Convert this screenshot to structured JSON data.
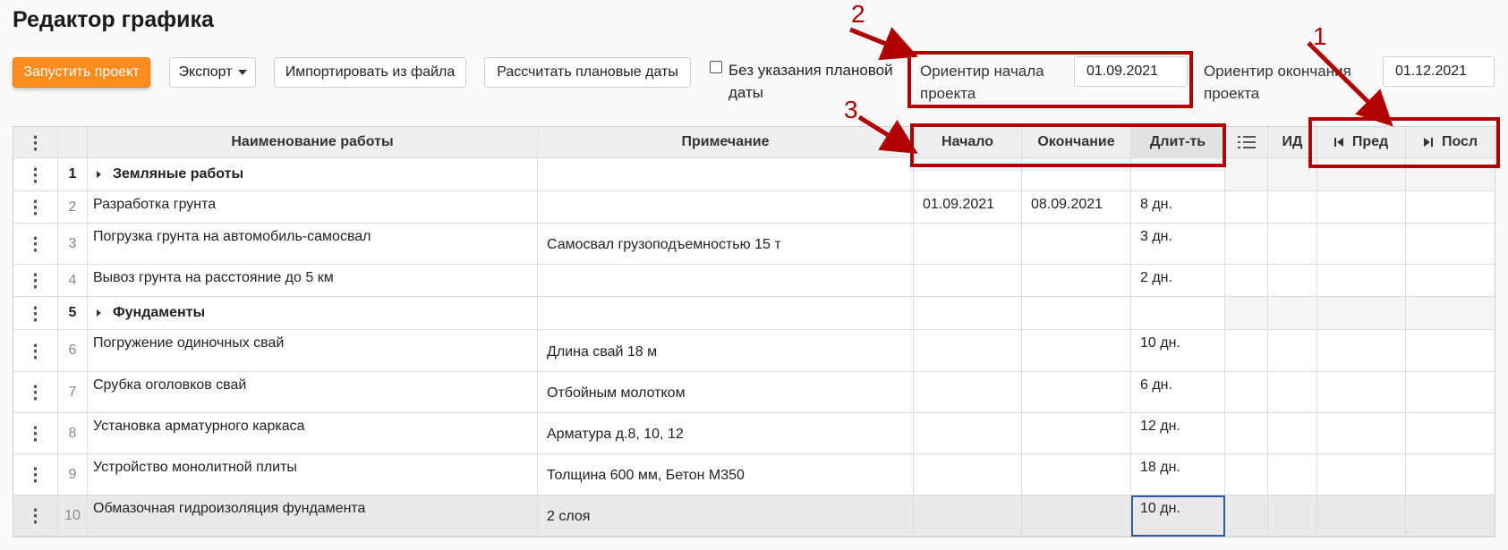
{
  "title": "Редактор графика",
  "toolbar": {
    "start_project": "Запустить проект",
    "export": "Экспорт",
    "import": "Импортировать из файла",
    "calc_dates": "Рассчитать плановые даты",
    "no_planned_date": "Без указания плановой даты",
    "start_label": "Ориентир начала проекта",
    "start_value": "01.09.2021",
    "end_label": "Ориентир окончания проекта",
    "end_value": "01.12.2021"
  },
  "table": {
    "headers": {
      "name": "Наименование работы",
      "note": "Примечание",
      "start": "Начало",
      "end": "Окончание",
      "duration": "Длит-ть",
      "id": "ИД",
      "prev": "Пред",
      "next": "Посл"
    },
    "rows": [
      {
        "num": "1",
        "name": "Земляные работы",
        "note": "",
        "start": "",
        "end": "",
        "dur": "",
        "group": true
      },
      {
        "num": "2",
        "name": "Разработка грунта",
        "note": "",
        "start": "01.09.2021",
        "end": "08.09.2021",
        "dur": "8 дн.",
        "group": false
      },
      {
        "num": "3",
        "name": "Погрузка грунта на автомобиль-самосвал",
        "note": "Самосвал грузоподъемностью 15 т",
        "start": "",
        "end": "",
        "dur": "3 дн.",
        "group": false
      },
      {
        "num": "4",
        "name": "Вывоз грунта на расстояние до 5 км",
        "note": "",
        "start": "",
        "end": "",
        "dur": "2 дн.",
        "group": false
      },
      {
        "num": "5",
        "name": "Фундаменты",
        "note": "",
        "start": "",
        "end": "",
        "dur": "",
        "group": true
      },
      {
        "num": "6",
        "name": "Погружение одиночных свай",
        "note": "Длина свай 18 м",
        "start": "",
        "end": "",
        "dur": "10 дн.",
        "group": false
      },
      {
        "num": "7",
        "name": "Срубка оголовков свай",
        "note": "Отбойным молотком",
        "start": "",
        "end": "",
        "dur": "6 дн.",
        "group": false
      },
      {
        "num": "8",
        "name": "Установка арматурного каркаса",
        "note": "Арматура д.8, 10, 12",
        "start": "",
        "end": "",
        "dur": "12 дн.",
        "group": false
      },
      {
        "num": "9",
        "name": "Устройство монолитной плиты",
        "note": "Толщина 600 мм, Бетон М350",
        "start": "",
        "end": "",
        "dur": "18 дн.",
        "group": false
      },
      {
        "num": "10",
        "name": "Обмазочная гидроизоляция фундамента",
        "note": "2 слоя",
        "start": "",
        "end": "",
        "dur": "10 дн.",
        "group": false,
        "selected": true
      }
    ]
  },
  "annotations": {
    "a1": "1",
    "a2": "2",
    "a3": "3"
  },
  "colors": {
    "primary": "#fb8c1e",
    "annotation": "#b00000",
    "selection": "#2f5aa8"
  }
}
